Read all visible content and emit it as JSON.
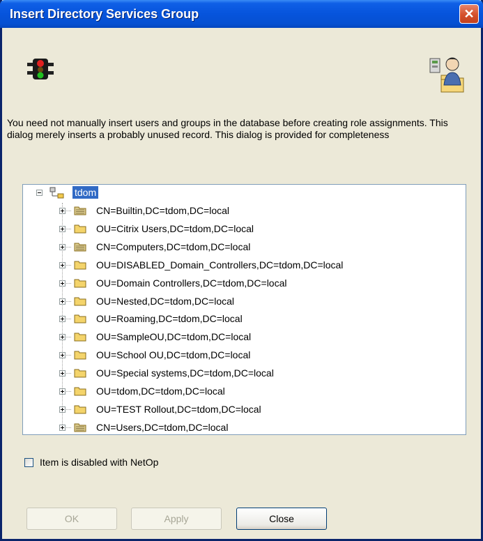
{
  "window": {
    "title": "Insert Directory Services Group",
    "close_glyph": "✕"
  },
  "icons": {
    "traffic": "traffic-light-icon",
    "users": "directory-users-icon"
  },
  "description": "You need not manually insert users and groups in the database before creating role assignments. This dialog merely inserts a probably unused record. This dialog is provided for completeness",
  "tree": {
    "root": "tdom",
    "items": [
      {
        "label": "CN=Builtin,DC=tdom,DC=local",
        "icon": "container-icon"
      },
      {
        "label": "OU=Citrix Users,DC=tdom,DC=local",
        "icon": "folder-icon"
      },
      {
        "label": "CN=Computers,DC=tdom,DC=local",
        "icon": "container-icon"
      },
      {
        "label": "OU=DISABLED_Domain_Controllers,DC=tdom,DC=local",
        "icon": "folder-icon"
      },
      {
        "label": "OU=Domain Controllers,DC=tdom,DC=local",
        "icon": "folder-icon"
      },
      {
        "label": "OU=Nested,DC=tdom,DC=local",
        "icon": "folder-icon"
      },
      {
        "label": "OU=Roaming,DC=tdom,DC=local",
        "icon": "folder-icon"
      },
      {
        "label": "OU=SampleOU,DC=tdom,DC=local",
        "icon": "folder-icon"
      },
      {
        "label": "OU=School OU,DC=tdom,DC=local",
        "icon": "folder-icon"
      },
      {
        "label": "OU=Special systems,DC=tdom,DC=local",
        "icon": "folder-icon"
      },
      {
        "label": "OU=tdom,DC=tdom,DC=local",
        "icon": "folder-icon"
      },
      {
        "label": "OU=TEST Rollout,DC=tdom,DC=local",
        "icon": "folder-icon"
      },
      {
        "label": "CN=Users,DC=tdom,DC=local",
        "icon": "container-icon"
      }
    ]
  },
  "checkbox": {
    "label": "Item is disabled with NetOp",
    "checked": false
  },
  "buttons": {
    "ok": "OK",
    "apply": "Apply",
    "close": "Close"
  },
  "colors": {
    "titlebar": "#0654DC",
    "selection": "#316AC5",
    "dialog_bg": "#ECE9D8",
    "close_button": "#D44F2C"
  }
}
